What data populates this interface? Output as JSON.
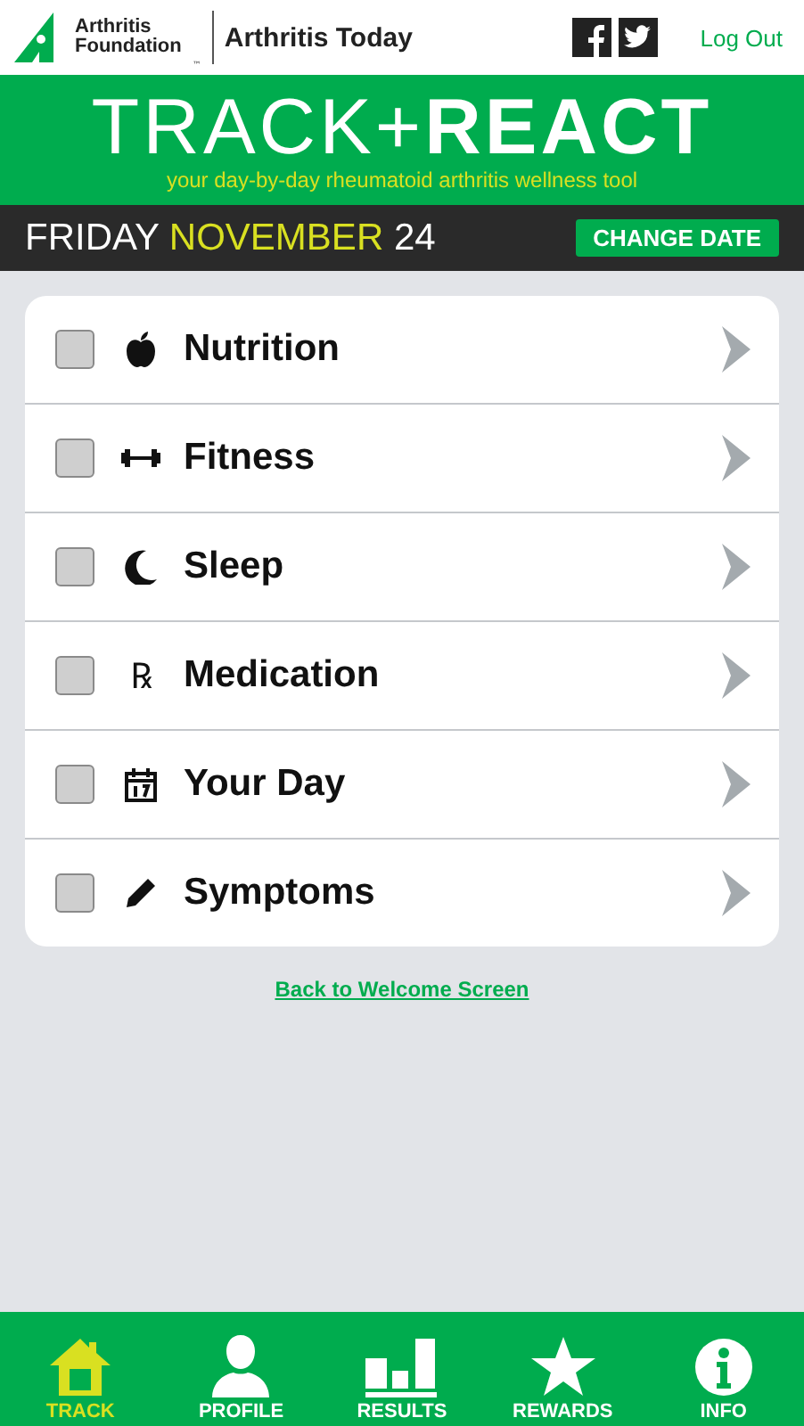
{
  "header": {
    "logo_lines": [
      "Arthritis",
      "Foundation"
    ],
    "trademark": "™",
    "partner": "Arthritis Today",
    "logout": "Log Out"
  },
  "banner": {
    "title_light": "TRACK+",
    "title_bold": "REACT",
    "tagline": "your day-by-day rheumatoid arthritis wellness tool"
  },
  "date_bar": {
    "weekday": "FRIDAY",
    "month": "NOVEMBER",
    "day": "24",
    "button": "CHANGE DATE"
  },
  "tracker_items": [
    {
      "label": "Nutrition",
      "kind": "apple",
      "checked": false
    },
    {
      "label": "Fitness",
      "kind": "dumbbell",
      "checked": false
    },
    {
      "label": "Sleep",
      "kind": "moon",
      "checked": false
    },
    {
      "label": "Medication",
      "kind": "glyph",
      "glyph": "℞",
      "checked": false
    },
    {
      "label": "Your Day",
      "kind": "calendar",
      "checked": false
    },
    {
      "label": "Symptoms",
      "kind": "pencil",
      "checked": false
    }
  ],
  "back_link": "Back to Welcome Screen",
  "nav": [
    {
      "label": "TRACK",
      "kind": "home",
      "selected": true
    },
    {
      "label": "PROFILE",
      "kind": "person",
      "selected": false
    },
    {
      "label": "RESULTS",
      "kind": "bars",
      "selected": false
    },
    {
      "label": "REWARDS",
      "kind": "star",
      "selected": false
    },
    {
      "label": "INFO",
      "kind": "info",
      "selected": false
    }
  ]
}
